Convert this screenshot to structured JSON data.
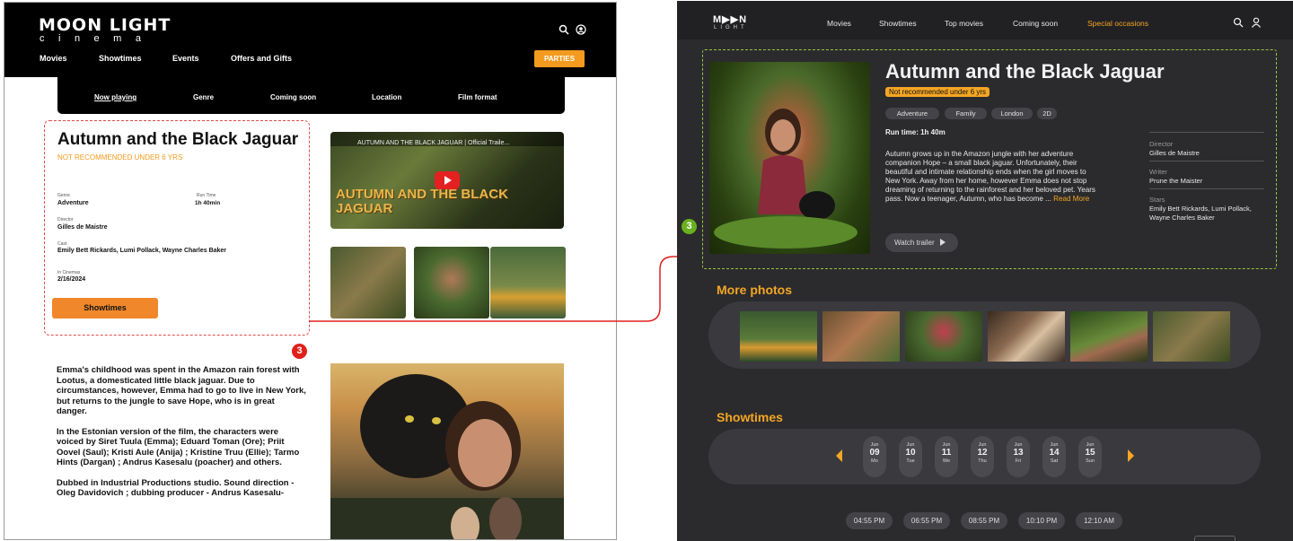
{
  "left": {
    "logo": {
      "main": "MOON LIGHT",
      "sub": "cinema"
    },
    "nav": [
      "Movies",
      "Showtimes",
      "Events",
      "Offers and Gifts"
    ],
    "parties_button": "PARTIES",
    "subnav": [
      "Now playing",
      "Genre",
      "Coming soon",
      "Location",
      "Film format"
    ],
    "movie": {
      "title": "Autumn and the Black Jaguar",
      "rating": "NOT RECOMMENDED UNDER 6 YRS",
      "genre_label": "Genre",
      "genre": "Adventure",
      "runtime_label": "Run Time",
      "runtime": "1h 40min",
      "director_label": "Director",
      "director": "Gilles de Maistre",
      "cast_label": "Cast",
      "cast": "Emily Bett Rickards, Lumi Pollack, Wayne Charles Baker",
      "release_label": "In Cinemas",
      "release": "2/16/2024",
      "showtimes_button": "Showtimes"
    },
    "video_title": "AUTUMN AND THE BLACK JAGUAR | Official Traile...",
    "video_poster_text": "AUTUMN AND THE BLACK JAGUAR",
    "story": [
      "Emma's childhood was spent in the Amazon rain forest with Lootus, a domesticated little black jaguar. Due to circumstances, however, Emma had to go to live in New York, but returns to the jungle to save Hope, who is in great danger.",
      "In the Estonian version of the film, the characters were voiced by Siret Tuula (Emma); Eduard Toman (Ore); Priit Oovel (Saul); Kristi Aule (Anija) ; Kristine Truu (Ellie); Tarmo Hints (Dargan) ; Andrus Kasesalu (poacher) and others.",
      "Dubbed in Industrial Productions studio. Sound direction - Oleg Davidovich ; dubbing producer - Andrus Kasesalu-"
    ],
    "marker": "3"
  },
  "right": {
    "logo": {
      "main": "M▶▶N",
      "sub": "LIGHT"
    },
    "nav": [
      "Movies",
      "Showtimes",
      "Top movies",
      "Coming soon",
      "Special occasions"
    ],
    "movie": {
      "title": "Autumn and the Black Jaguar",
      "rating": "Not recommended under 6 yrs",
      "tags": [
        "Adventure",
        "Family",
        "London",
        "2D"
      ],
      "runtime": "Run time: 1h 40m",
      "synopsis": "Autumn grows up in the Amazon jungle with her adventure companion Hope – a small black jaguar. Unfortunately, their beautiful and intimate relationship ends when the girl moves to New York. Away from her home, however Emma does not stop dreaming of returning to the rainforest and her beloved pet. Years pass. Now a teenager, Autumn, who has become ...",
      "read_more": "Read More",
      "watch_trailer": "Watch trailer",
      "director_label": "Director",
      "director": "Gilles de Maistre",
      "writer_label": "Writer",
      "writer": "Prune  the Maister",
      "stars_label": "Stars",
      "stars": "Emily Bett Rickards, Lumi Pollack, Wayne Charles Baker"
    },
    "more_photos_heading": "More photos",
    "showtimes_heading": "Showtimes",
    "dates": [
      {
        "month": "Jun",
        "day": "09",
        "weekday": "Mo"
      },
      {
        "month": "Jun",
        "day": "10",
        "weekday": "Tue"
      },
      {
        "month": "Jun",
        "day": "11",
        "weekday": "We"
      },
      {
        "month": "Jun",
        "day": "12",
        "weekday": "Thu"
      },
      {
        "month": "Jun",
        "day": "13",
        "weekday": "Fri"
      },
      {
        "month": "Jun",
        "day": "14",
        "weekday": "Sat"
      },
      {
        "month": "Jun",
        "day": "15",
        "weekday": "Sun"
      }
    ],
    "times": [
      "04:55 PM",
      "06:55 PM",
      "08:55 PM",
      "10:10 PM",
      "12:10 AM"
    ],
    "marker": "3"
  },
  "colors": {
    "accent": "#f5a623",
    "left_dashed": "#e24a4a",
    "right_dashed": "#9bc53d",
    "connector": "#e02020"
  }
}
